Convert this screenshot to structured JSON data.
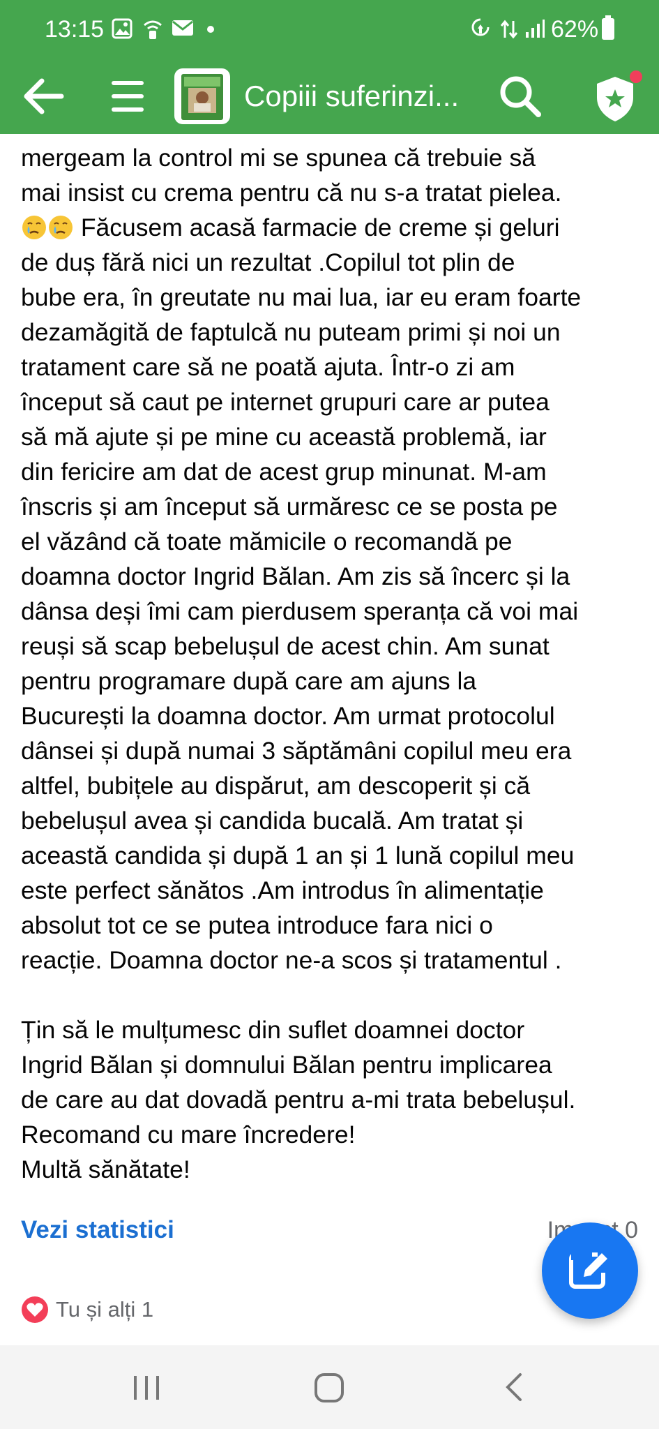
{
  "status_bar": {
    "time": "13:15",
    "battery": "62%",
    "icons": [
      "gallery-icon",
      "wifi-call-icon",
      "mail-icon",
      "dot-icon",
      "battery-saver-icon",
      "data-icon",
      "signal-icon",
      "battery-icon"
    ]
  },
  "app_bar": {
    "title": "Copiii suferinzi...",
    "background": "#45a64e",
    "icons": [
      "back-arrow-icon",
      "menu-icon",
      "group-thumbnail",
      "search-icon",
      "admin-shield-icon"
    ]
  },
  "post": {
    "paragraph1": [
      "mergeam la control mi se spunea că trebuie să",
      "mai insist cu crema pentru că nu s-a tratat pielea.",
      " Făcusem acasă farmacie de creme și geluri",
      "de duș  fără nici un rezultat .Copilul tot plin de",
      "bube era, în greutate nu mai lua, iar eu eram foarte",
      "dezamăgită de faptulcă nu puteam primi și noi un",
      "tratament care să ne poată ajuta. Într-o zi   am",
      "început să caut pe internet grupuri care ar putea",
      "să mă ajute și pe mine cu această problemă, iar",
      "din fericire am dat de acest grup minunat.  M-am",
      "înscris și am început să urmăresc ce se posta pe",
      "el văzând că toate mămicile o recomandă pe",
      "doamna doctor Ingrid Bălan. Am zis să încerc și la",
      "dânsa deși îmi cam pierdusem speranța că voi mai",
      "reuși să scap bebelușul de acest chin. Am sunat",
      "pentru programare după care am ajuns la",
      "București  la doamna doctor.  Am urmat protocolul",
      "dânsei și după numai 3 săptămâni copilul meu era",
      "altfel, bubițele au dispărut,  am descoperit și că",
      "bebelușul avea și candida bucală. Am tratat și",
      "această candida  și după 1 an și 1 lună copilul meu",
      "este perfect sănătos   .Am introdus în alimentație",
      "absolut tot ce se putea introduce fara nici o",
      "reacție. Doamna doctor ne-a scos și tratamentul ."
    ],
    "paragraph2": [
      "Țin să le mulțumesc din suflet doamnei doctor",
      "Ingrid Bălan  și domnului Bălan pentru implicarea",
      "de care au dat dovadă pentru a-mi trata bebelușul.",
      "Recomand cu mare încredere!",
      "Multă sănătate!"
    ],
    "emoji": [
      "crying-face-emoji",
      "crying-face-emoji"
    ]
  },
  "footer": {
    "view_stats": "Vezi statistici",
    "impact": "Impact 0",
    "reactions": "Tu și alți 1",
    "reaction_icon": "heart-icon",
    "accent": "#1877f2"
  },
  "nav_bar": {
    "icons": [
      "recents-icon",
      "home-icon",
      "back-icon"
    ]
  }
}
